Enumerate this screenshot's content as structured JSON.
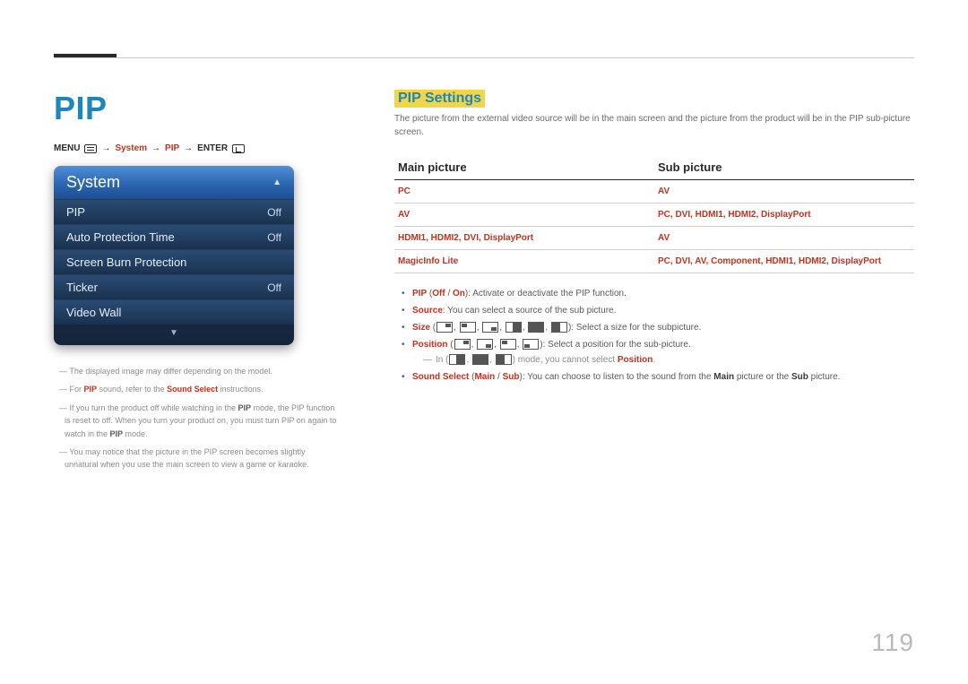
{
  "page_number": "119",
  "left": {
    "title": "PIP",
    "breadcrumb": {
      "menu": "MENU",
      "system": "System",
      "pip": "PIP",
      "enter": "ENTER"
    },
    "osd": {
      "title": "System",
      "rows": [
        {
          "label": "PIP",
          "value": "Off"
        },
        {
          "label": "Auto Protection Time",
          "value": "Off"
        },
        {
          "label": "Screen Burn Protection",
          "value": ""
        },
        {
          "label": "Ticker",
          "value": "Off"
        },
        {
          "label": "Video Wall",
          "value": ""
        }
      ]
    },
    "notes": {
      "n1": "The displayed image may differ depending on the model.",
      "n2a": "For ",
      "n2b": "PIP",
      "n2c": " sound, refer to the ",
      "n2d": "Sound Select",
      "n2e": " instructions.",
      "n3a": "If you turn the product off while watching in the ",
      "n3b": "PIP",
      "n3c": " mode, the PIP function is reset to off. When you turn your product on, you must turn PIP on again to watch in the ",
      "n3d": "PIP",
      "n3e": " mode.",
      "n4": "You may notice that the picture in the PIP screen becomes slightly unnatural when you use the main screen to view a game or karaoke."
    }
  },
  "right": {
    "heading": "PIP Settings",
    "intro": "The picture from the external video source will be in the main screen and the picture from the product will be in the PIP sub-picture screen.",
    "table": {
      "head": {
        "main": "Main picture",
        "sub": "Sub picture"
      },
      "rows": [
        {
          "main": "PC",
          "sub": "AV"
        },
        {
          "main": "AV",
          "sub": "PC, DVI, HDMI1, HDMI2, DisplayPort"
        },
        {
          "main": "HDMI1, HDMI2, DVI, DisplayPort",
          "sub": "AV"
        },
        {
          "main": "MagicInfo Lite",
          "sub": "PC, DVI, AV, Component, HDMI1, HDMI2, DisplayPort"
        }
      ]
    },
    "bullets": {
      "b1_a": "PIP",
      "b1_b": " (",
      "b1_c": "Off",
      "b1_d": " / ",
      "b1_e": "On",
      "b1_f": "): Activate or deactivate the PIP function.",
      "b2_a": "Source",
      "b2_b": ": You can select a source of the sub picture.",
      "b3_a": "Size",
      "b3_tail": ": Select a size for the subpicture.",
      "b4_a": "Position",
      "b4_tail": ": Select a position for the sub-picture.",
      "b4_sub_a": "In",
      "b4_sub_b": " mode, you cannot select ",
      "b4_sub_c": "Position",
      "b4_sub_d": ".",
      "b5_a": "Sound Select",
      "b5_b": " (",
      "b5_c": "Main",
      "b5_d": " / ",
      "b5_e": "Sub",
      "b5_f": "): You can choose to listen to the sound from the ",
      "b5_g": "Main",
      "b5_h": " picture or the ",
      "b5_i": "Sub",
      "b5_j": " picture."
    }
  }
}
